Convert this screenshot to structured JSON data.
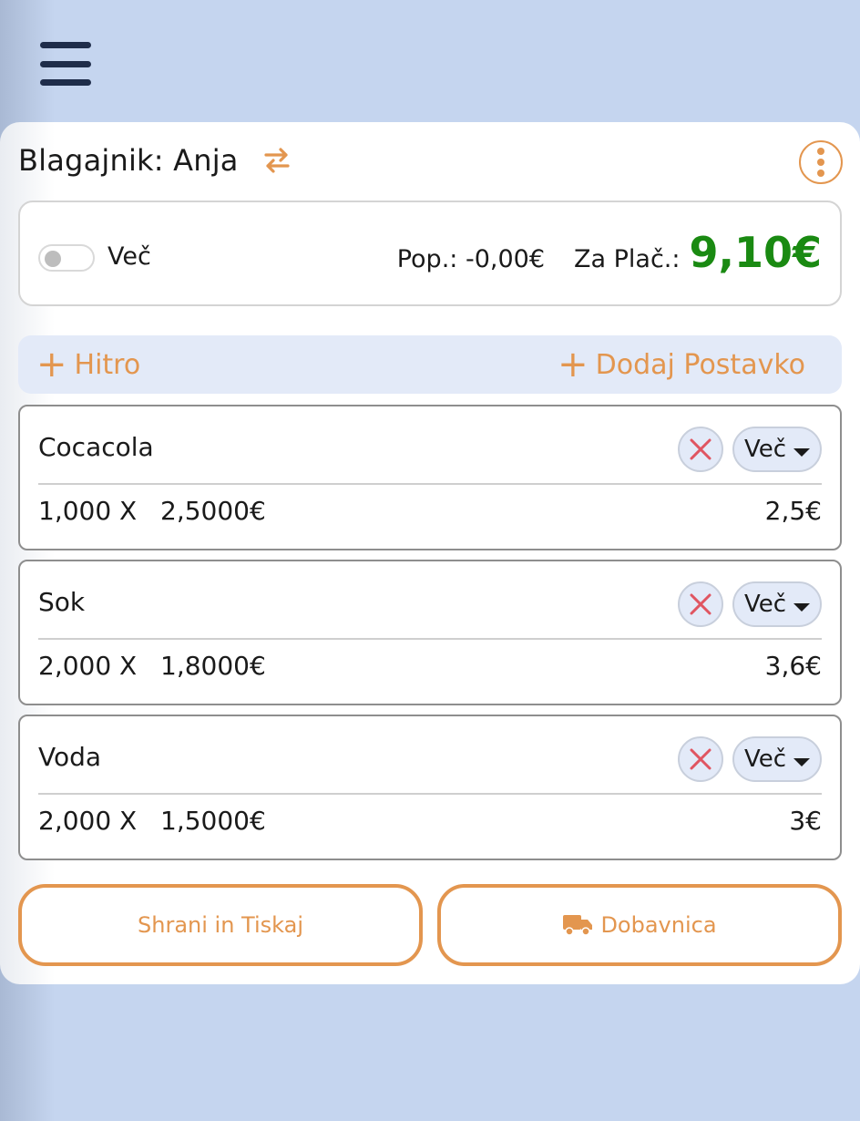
{
  "header": {
    "menu_icon": "hamburger-icon"
  },
  "cashier": {
    "label": "Blagajnik: Anja",
    "swap_icon": "swap-arrows-icon",
    "more_icon": "kebab-menu-icon"
  },
  "summary": {
    "toggle_label": "Več",
    "toggle_on": false,
    "discount_text": "Pop.: -0,00€",
    "to_pay_label": "Za Plač.:",
    "to_pay_amount": "9,10€"
  },
  "actions": {
    "quick_label": "Hitro",
    "add_item_label": "Dodaj Postavko"
  },
  "items": [
    {
      "name": "Cocacola",
      "qty": "1,000 X",
      "price": "2,5000€",
      "total": "2,5€",
      "more_label": "Več"
    },
    {
      "name": "Sok",
      "qty": "2,000 X",
      "price": "1,8000€",
      "total": "3,6€",
      "more_label": "Več"
    },
    {
      "name": "Voda",
      "qty": "2,000 X",
      "price": "1,5000€",
      "total": "3€",
      "more_label": "Več"
    }
  ],
  "buttons": {
    "save_print": "Shrani in Tiskaj",
    "delivery_note": "Dobavnica"
  },
  "colors": {
    "accent": "#e3964f",
    "total_green": "#1a8a12",
    "background": "#c5d5ef"
  }
}
